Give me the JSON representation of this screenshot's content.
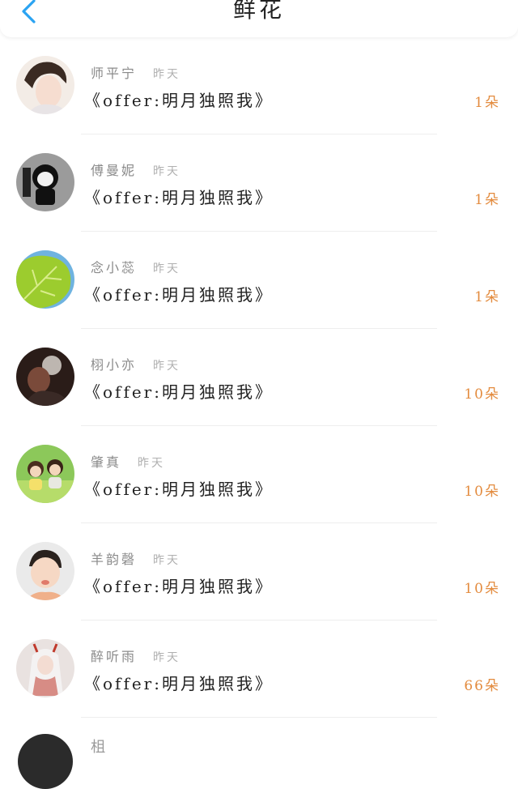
{
  "header": {
    "title": "鲜花",
    "back_icon": "chevron-left-icon",
    "accent": "#2aa3f2"
  },
  "items": [
    {
      "name": "师平宁",
      "time": "昨天",
      "book": "《offer:明月独照我》",
      "count": "1朵"
    },
    {
      "name": "傅曼妮",
      "time": "昨天",
      "book": "《offer:明月独照我》",
      "count": "1朵"
    },
    {
      "name": "念小蕊",
      "time": "昨天",
      "book": "《offer:明月独照我》",
      "count": "1朵"
    },
    {
      "name": "栩小亦",
      "time": "昨天",
      "book": "《offer:明月独照我》",
      "count": "10朵"
    },
    {
      "name": "肇真",
      "time": "昨天",
      "book": "《offer:明月独照我》",
      "count": "10朵"
    },
    {
      "name": "羊韵磬",
      "time": "昨天",
      "book": "《offer:明月独照我》",
      "count": "10朵"
    },
    {
      "name": "醉听雨",
      "time": "昨天",
      "book": "《offer:明月独照我》",
      "count": "66朵"
    }
  ],
  "partial_item": {
    "name": "柤"
  },
  "colors": {
    "count": "#e38b3e",
    "name": "#8a8a8a",
    "time": "#b0b0b0"
  }
}
